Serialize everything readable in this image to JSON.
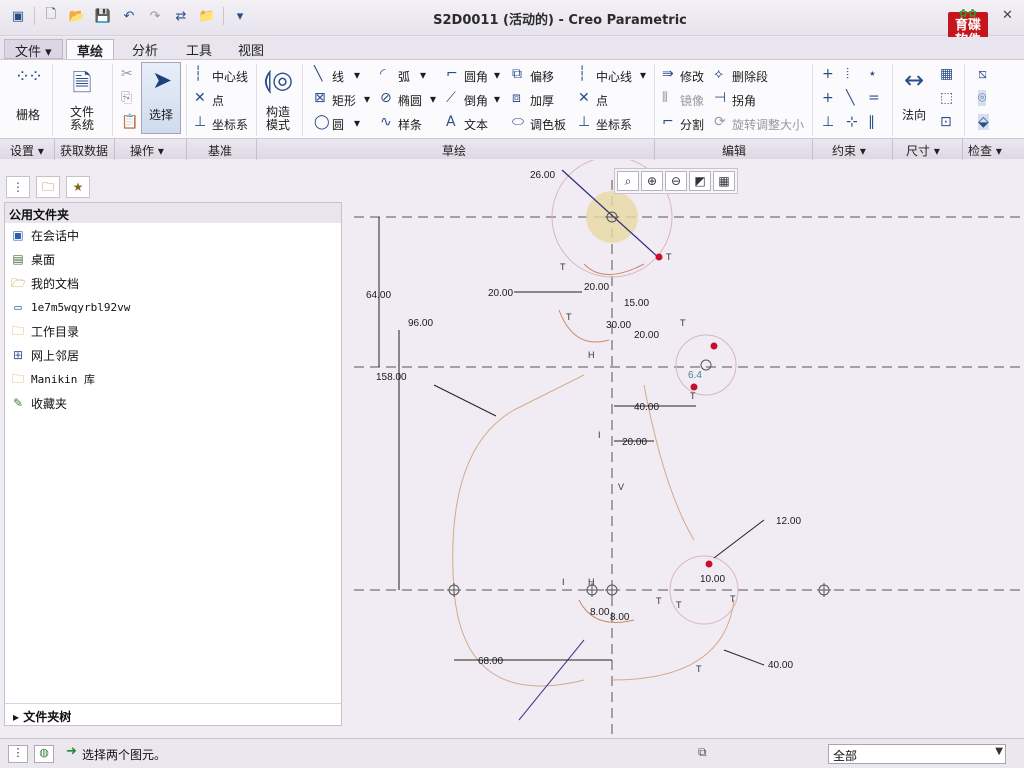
{
  "window": {
    "title": "S2D0011 (活动的) - Creo Parametric",
    "minimize": "—",
    "close": "✕",
    "logo_top": "育碟",
    "logo_bottom": "软件",
    "help": "?"
  },
  "tabs": [
    "文件 ▾",
    "草绘",
    "分析",
    "工具",
    "视图"
  ],
  "ribbon": {
    "grid": "栅格",
    "file_system": [
      "文件",
      "系统"
    ],
    "select": "选择",
    "datum": {
      "centerline": "中心线",
      "point": "点",
      "csys": "坐标系"
    },
    "construction_mode": [
      "构造",
      "模式"
    ],
    "sketch_col1": {
      "line": "线",
      "rectangle": "矩形",
      "circle": "圆"
    },
    "sketch_col2": {
      "arc": "弧",
      "ellipse": "椭圆",
      "spline": "样条"
    },
    "sketch_col3": {
      "fillet": "圆角",
      "chamfer": "倒角",
      "text": "文本"
    },
    "sketch_col4": {
      "offset": "偏移",
      "thicken": "加厚",
      "palette": "调色板"
    },
    "sketch_col5": {
      "centerline": "中心线",
      "point": "点",
      "csys": "坐标系"
    },
    "edit": {
      "modify": "修改",
      "delete_segment": "删除段",
      "mirror": "镜像",
      "corner": "拐角",
      "divide": "分割",
      "rotate_resize": "旋转调整大小"
    },
    "normal": "法向"
  },
  "groups": [
    "设置 ▾",
    "获取数据",
    "操作 ▾",
    "基准",
    "草绘",
    "编辑",
    "约束 ▾",
    "尺寸 ▾",
    "检查 ▾"
  ],
  "left_panel": {
    "header": "公用文件夹",
    "items": [
      {
        "label": "在会话中",
        "icon": "session-icon"
      },
      {
        "label": "桌面",
        "icon": "desktop-icon"
      },
      {
        "label": "我的文档",
        "icon": "documents-icon"
      },
      {
        "label": "1e7m5wqyrbl92vw",
        "icon": "computer-icon"
      },
      {
        "label": "工作目录",
        "icon": "working-dir-icon"
      },
      {
        "label": "网上邻居",
        "icon": "network-icon"
      },
      {
        "label": "Manikin 库",
        "icon": "manikin-icon"
      },
      {
        "label": "收藏夹",
        "icon": "favorites-icon"
      }
    ],
    "footer": "文件夹树"
  },
  "dimensions": [
    "26.00",
    "64.00",
    "96.00",
    "158.00",
    "20.00",
    "20.00",
    "15.00",
    "30.00",
    "20.00",
    "6.4",
    "40.00",
    "20.00",
    "12.00",
    "10.00",
    "8.00",
    "8.00",
    "68.00",
    "40.00"
  ],
  "status": {
    "message": "选择两个图元。",
    "filter": "全部"
  }
}
